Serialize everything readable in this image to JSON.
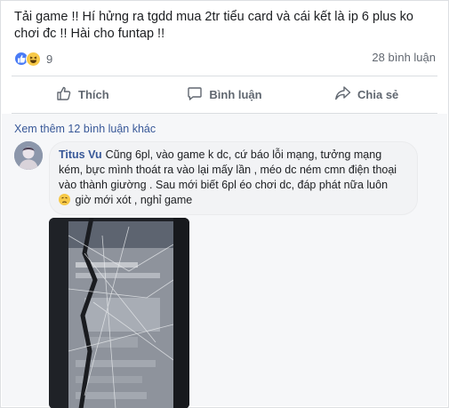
{
  "post": {
    "text": "Tải game !! Hí hửng ra tgdd mua 2tr tiểu card và cái kết là ip 6 plus ko chơi đc !! Hài cho funtap !!",
    "reaction_count": "9",
    "comments_count": "28 bình luận"
  },
  "actions": {
    "like": "Thích",
    "comment": "Bình luận",
    "share": "Chia sẻ"
  },
  "comments": {
    "more_label": "Xem thêm 12 bình luận khác",
    "first": {
      "author": "Titus Vu",
      "text": "Cũng 6pl, vào game k dc, cứ báo lỗi mạng, tưởng mạng kém, bực mình thoát ra vào lại mấy lần , méo dc ném cmn điện thoại vào thành giường . Sau mới biết 6pl éo chơi dc, đáp phát nữa luôn",
      "text_end": "giờ mới xót , nghỉ game"
    }
  },
  "colors": {
    "link": "#385898",
    "like_reaction": "#4a7cf6",
    "haha_reaction": "#f7c948"
  },
  "icons": [
    "like-reaction-icon",
    "haha-reaction-icon",
    "thumbs-up-icon",
    "comment-icon",
    "share-icon",
    "sad-emoji-icon"
  ]
}
